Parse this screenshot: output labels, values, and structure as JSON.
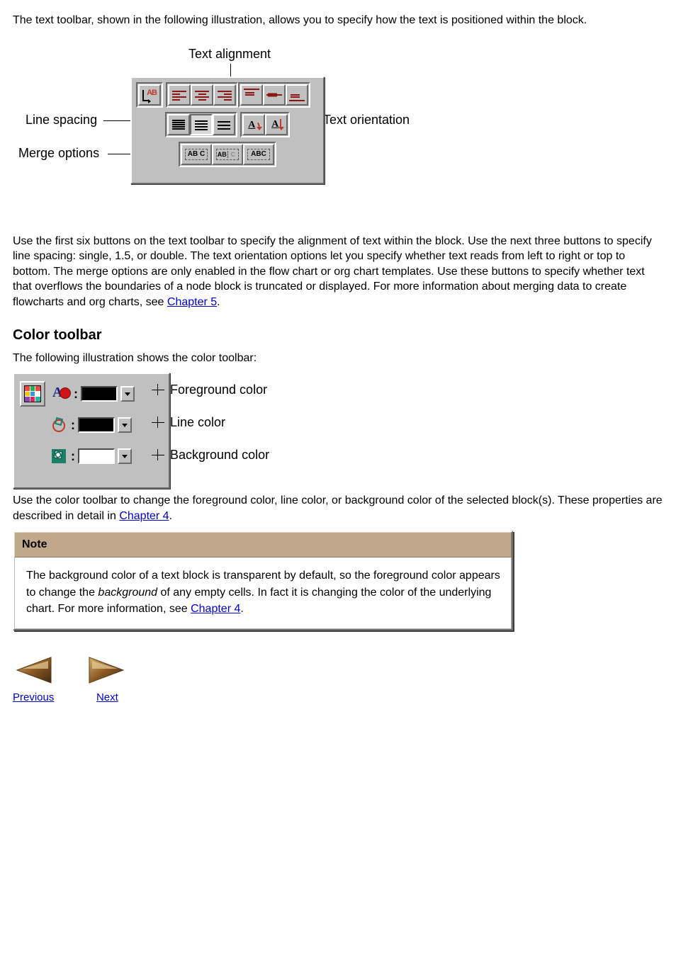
{
  "intro": "The text toolbar, shown in the following illustration, allows you to specify how the text is positioned within the block.",
  "text_figure": {
    "callouts": {
      "top": "Text alignment",
      "left_mid": "Line spacing",
      "left_bot": "Merge options",
      "right_mid": "Text orientation"
    },
    "buttons": {
      "wrap_ab": "AB",
      "orientation_glyph": "A",
      "merge1": "AB C",
      "merge2_a": "AB",
      "merge2_b": "C",
      "merge3": "ABC"
    }
  },
  "text_para": {
    "p1a": "Use the first six buttons on the text toolbar to specify the alignment of text within the block. Use the next three buttons to specify line spacing: single, 1.5, or double. The text orientation options let you specify whether text reads from left to right or top to bottom. The merge options are only enabled in the flow chart or org chart templates. Use these buttons to specify whether text that overflows the boundaries of a node block is truncated or displayed. For more information about merging data to create flowcharts and org charts, see ",
    "link1": "Chapter 5",
    "p1b": "."
  },
  "color_heading": "Color toolbar",
  "color_intro": "The following illustration shows the color toolbar:",
  "color_figure": {
    "fg_label": "Foreground color",
    "line_label": "Line color",
    "bg_label": "Background color",
    "colors": {
      "fg": "#000000",
      "line": "#000000",
      "bg": "#ffffff"
    },
    "colon": ":"
  },
  "color_para": {
    "p1a": "Use the color toolbar to change the foreground color, line color, or background color of the selected block(s). These properties are described in detail in ",
    "link1": "Chapter 4",
    "p1b": "."
  },
  "note": {
    "head": "Note",
    "body_a": "The background color of a text block is transparent by default, so the foreground color appears to change the ",
    "body_em": "background",
    "body_b": " of any empty cells. In fact it is changing the color of the underlying chart. For more information, see ",
    "body_link": "Chapter 4",
    "body_c": "."
  },
  "nav": {
    "prev": "Previous",
    "next": "Next"
  }
}
